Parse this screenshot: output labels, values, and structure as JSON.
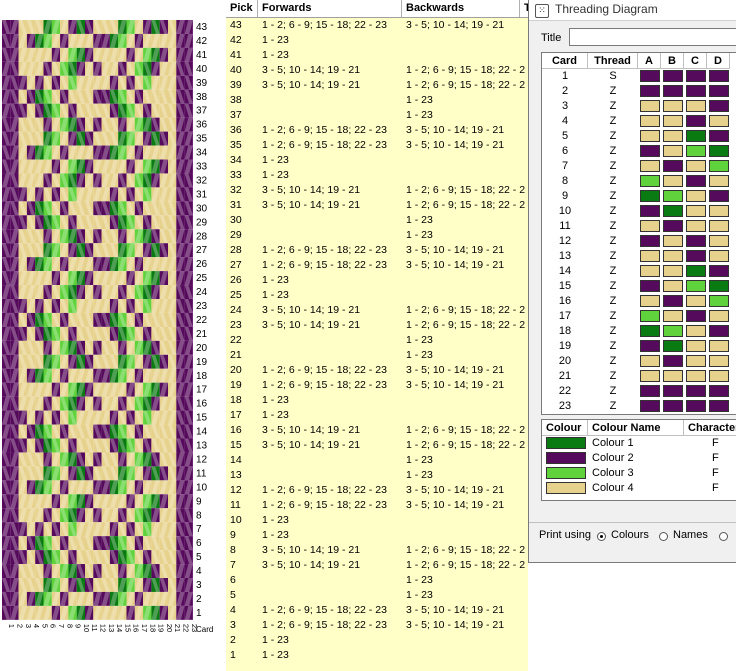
{
  "colors": {
    "colour1": "#0a7a12",
    "colour2": "#560a5c",
    "colour3": "#5fd23c",
    "colour4": "#e6d28c",
    "pick_bg": "#ffffc8"
  },
  "pattern": {
    "pick_numbers": [
      "43",
      "42",
      "41",
      "40",
      "39",
      "38",
      "37",
      "36",
      "35",
      "34",
      "33",
      "32",
      "31",
      "30",
      "29",
      "28",
      "27",
      "26",
      "25",
      "24",
      "23",
      "22",
      "21",
      "20",
      "19",
      "18",
      "17",
      "16",
      "15",
      "14",
      "13",
      "12",
      "11",
      "10",
      "9",
      "8",
      "7",
      "6",
      "5",
      "4",
      "3",
      "2",
      "1"
    ],
    "card_numbers": [
      "1",
      "2",
      "3",
      "4",
      "5",
      "6",
      "7",
      "8",
      "9",
      "10",
      "11",
      "12",
      "13",
      "14",
      "15",
      "16",
      "17",
      "18",
      "19",
      "20",
      "21",
      "22",
      "23"
    ],
    "card_label": "Card"
  },
  "pick_table": {
    "headers": {
      "pick": "Pick",
      "forwards": "Forwards",
      "backwards": "Backwards",
      "extra": "T"
    },
    "rows": [
      {
        "pick": "43",
        "forwards": "1 - 2; 6 - 9; 15 - 18; 22 - 23",
        "backwards": "3 - 5; 10 - 14; 19 - 21"
      },
      {
        "pick": "42",
        "forwards": "1 - 23",
        "backwards": ""
      },
      {
        "pick": "41",
        "forwards": "1 - 23",
        "backwards": ""
      },
      {
        "pick": "40",
        "forwards": "3 - 5; 10 - 14; 19 - 21",
        "backwards": "1 - 2; 6 - 9; 15 - 18; 22 - 2"
      },
      {
        "pick": "39",
        "forwards": "3 - 5; 10 - 14; 19 - 21",
        "backwards": "1 - 2; 6 - 9; 15 - 18; 22 - 2"
      },
      {
        "pick": "38",
        "forwards": "",
        "backwards": "1 - 23"
      },
      {
        "pick": "37",
        "forwards": "",
        "backwards": "1 - 23"
      },
      {
        "pick": "36",
        "forwards": "1 - 2; 6 - 9; 15 - 18; 22 - 23",
        "backwards": "3 - 5; 10 - 14; 19 - 21"
      },
      {
        "pick": "35",
        "forwards": "1 - 2; 6 - 9; 15 - 18; 22 - 23",
        "backwards": "3 - 5; 10 - 14; 19 - 21"
      },
      {
        "pick": "34",
        "forwards": "1 - 23",
        "backwards": ""
      },
      {
        "pick": "33",
        "forwards": "1 - 23",
        "backwards": ""
      },
      {
        "pick": "32",
        "forwards": "3 - 5; 10 - 14; 19 - 21",
        "backwards": "1 - 2; 6 - 9; 15 - 18; 22 - 2"
      },
      {
        "pick": "31",
        "forwards": "3 - 5; 10 - 14; 19 - 21",
        "backwards": "1 - 2; 6 - 9; 15 - 18; 22 - 2"
      },
      {
        "pick": "30",
        "forwards": "",
        "backwards": "1 - 23"
      },
      {
        "pick": "29",
        "forwards": "",
        "backwards": "1 - 23"
      },
      {
        "pick": "28",
        "forwards": "1 - 2; 6 - 9; 15 - 18; 22 - 23",
        "backwards": "3 - 5; 10 - 14; 19 - 21"
      },
      {
        "pick": "27",
        "forwards": "1 - 2; 6 - 9; 15 - 18; 22 - 23",
        "backwards": "3 - 5; 10 - 14; 19 - 21"
      },
      {
        "pick": "26",
        "forwards": "1 - 23",
        "backwards": ""
      },
      {
        "pick": "25",
        "forwards": "1 - 23",
        "backwards": ""
      },
      {
        "pick": "24",
        "forwards": "3 - 5; 10 - 14; 19 - 21",
        "backwards": "1 - 2; 6 - 9; 15 - 18; 22 - 2"
      },
      {
        "pick": "23",
        "forwards": "3 - 5; 10 - 14; 19 - 21",
        "backwards": "1 - 2; 6 - 9; 15 - 18; 22 - 2"
      },
      {
        "pick": "22",
        "forwards": "",
        "backwards": "1 - 23"
      },
      {
        "pick": "21",
        "forwards": "",
        "backwards": "1 - 23"
      },
      {
        "pick": "20",
        "forwards": "1 - 2; 6 - 9; 15 - 18; 22 - 23",
        "backwards": "3 - 5; 10 - 14; 19 - 21"
      },
      {
        "pick": "19",
        "forwards": "1 - 2; 6 - 9; 15 - 18; 22 - 23",
        "backwards": "3 - 5; 10 - 14; 19 - 21"
      },
      {
        "pick": "18",
        "forwards": "1 - 23",
        "backwards": ""
      },
      {
        "pick": "17",
        "forwards": "1 - 23",
        "backwards": ""
      },
      {
        "pick": "16",
        "forwards": "3 - 5; 10 - 14; 19 - 21",
        "backwards": "1 - 2; 6 - 9; 15 - 18; 22 - 2"
      },
      {
        "pick": "15",
        "forwards": "3 - 5; 10 - 14; 19 - 21",
        "backwards": "1 - 2; 6 - 9; 15 - 18; 22 - 2"
      },
      {
        "pick": "14",
        "forwards": "",
        "backwards": "1 - 23"
      },
      {
        "pick": "13",
        "forwards": "",
        "backwards": "1 - 23"
      },
      {
        "pick": "12",
        "forwards": "1 - 2; 6 - 9; 15 - 18; 22 - 23",
        "backwards": "3 - 5; 10 - 14; 19 - 21"
      },
      {
        "pick": "11",
        "forwards": "1 - 2; 6 - 9; 15 - 18; 22 - 23",
        "backwards": "3 - 5; 10 - 14; 19 - 21"
      },
      {
        "pick": "10",
        "forwards": "1 - 23",
        "backwards": ""
      },
      {
        "pick": "9",
        "forwards": "1 - 23",
        "backwards": ""
      },
      {
        "pick": "8",
        "forwards": "3 - 5; 10 - 14; 19 - 21",
        "backwards": "1 - 2; 6 - 9; 15 - 18; 22 - 2"
      },
      {
        "pick": "7",
        "forwards": "3 - 5; 10 - 14; 19 - 21",
        "backwards": "1 - 2; 6 - 9; 15 - 18; 22 - 2"
      },
      {
        "pick": "6",
        "forwards": "",
        "backwards": "1 - 23"
      },
      {
        "pick": "5",
        "forwards": "",
        "backwards": "1 - 23"
      },
      {
        "pick": "4",
        "forwards": "1 - 2; 6 - 9; 15 - 18; 22 - 23",
        "backwards": "3 - 5; 10 - 14; 19 - 21"
      },
      {
        "pick": "3",
        "forwards": "1 - 2; 6 - 9; 15 - 18; 22 - 23",
        "backwards": "3 - 5; 10 - 14; 19 - 21"
      },
      {
        "pick": "2",
        "forwards": "1 - 23",
        "backwards": ""
      },
      {
        "pick": "1",
        "forwards": "1 - 23",
        "backwards": ""
      }
    ]
  },
  "threading": {
    "window_title": "Threading Diagram",
    "title_label": "Title",
    "title_value": "",
    "grid_headers": {
      "card": "Card",
      "thread": "Thread",
      "a": "A",
      "b": "B",
      "c": "C",
      "d": "D"
    },
    "cards": [
      {
        "card": "1",
        "thread": "S",
        "holes": [
          2,
          2,
          2,
          2
        ]
      },
      {
        "card": "2",
        "thread": "Z",
        "holes": [
          2,
          2,
          2,
          2
        ]
      },
      {
        "card": "3",
        "thread": "Z",
        "holes": [
          4,
          4,
          4,
          2
        ]
      },
      {
        "card": "4",
        "thread": "Z",
        "holes": [
          4,
          4,
          2,
          4
        ]
      },
      {
        "card": "5",
        "thread": "Z",
        "holes": [
          4,
          4,
          1,
          2
        ]
      },
      {
        "card": "6",
        "thread": "Z",
        "holes": [
          2,
          4,
          3,
          1
        ]
      },
      {
        "card": "7",
        "thread": "Z",
        "holes": [
          4,
          2,
          4,
          3
        ]
      },
      {
        "card": "8",
        "thread": "Z",
        "holes": [
          3,
          4,
          2,
          4
        ]
      },
      {
        "card": "9",
        "thread": "Z",
        "holes": [
          1,
          3,
          4,
          2
        ]
      },
      {
        "card": "10",
        "thread": "Z",
        "holes": [
          2,
          1,
          4,
          4
        ]
      },
      {
        "card": "11",
        "thread": "Z",
        "holes": [
          4,
          2,
          4,
          4
        ]
      },
      {
        "card": "12",
        "thread": "Z",
        "holes": [
          2,
          4,
          2,
          4
        ]
      },
      {
        "card": "13",
        "thread": "Z",
        "holes": [
          4,
          4,
          2,
          4
        ]
      },
      {
        "card": "14",
        "thread": "Z",
        "holes": [
          4,
          4,
          1,
          2
        ]
      },
      {
        "card": "15",
        "thread": "Z",
        "holes": [
          2,
          4,
          3,
          1
        ]
      },
      {
        "card": "16",
        "thread": "Z",
        "holes": [
          4,
          2,
          4,
          3
        ]
      },
      {
        "card": "17",
        "thread": "Z",
        "holes": [
          3,
          4,
          2,
          4
        ]
      },
      {
        "card": "18",
        "thread": "Z",
        "holes": [
          1,
          3,
          4,
          2
        ]
      },
      {
        "card": "19",
        "thread": "Z",
        "holes": [
          2,
          1,
          4,
          4
        ]
      },
      {
        "card": "20",
        "thread": "Z",
        "holes": [
          4,
          2,
          4,
          4
        ]
      },
      {
        "card": "21",
        "thread": "Z",
        "holes": [
          4,
          4,
          4,
          4
        ]
      },
      {
        "card": "22",
        "thread": "Z",
        "holes": [
          2,
          2,
          2,
          2
        ]
      },
      {
        "card": "23",
        "thread": "Z",
        "holes": [
          2,
          2,
          2,
          2
        ]
      }
    ],
    "colour_headers": {
      "colour": "Colour",
      "name": "Colour Name",
      "character": "Character"
    },
    "colours": [
      {
        "name": "Colour 1",
        "character": "F",
        "colour": 1
      },
      {
        "name": "Colour 2",
        "character": "F",
        "colour": 2
      },
      {
        "name": "Colour 3",
        "character": "F",
        "colour": 3
      },
      {
        "name": "Colour 4",
        "character": "F",
        "colour": 4
      }
    ],
    "print_label": "Print using",
    "print_options": [
      {
        "label": "Colours",
        "selected": true
      },
      {
        "label": "Names",
        "selected": false
      },
      {
        "label": "",
        "selected": false
      }
    ]
  }
}
